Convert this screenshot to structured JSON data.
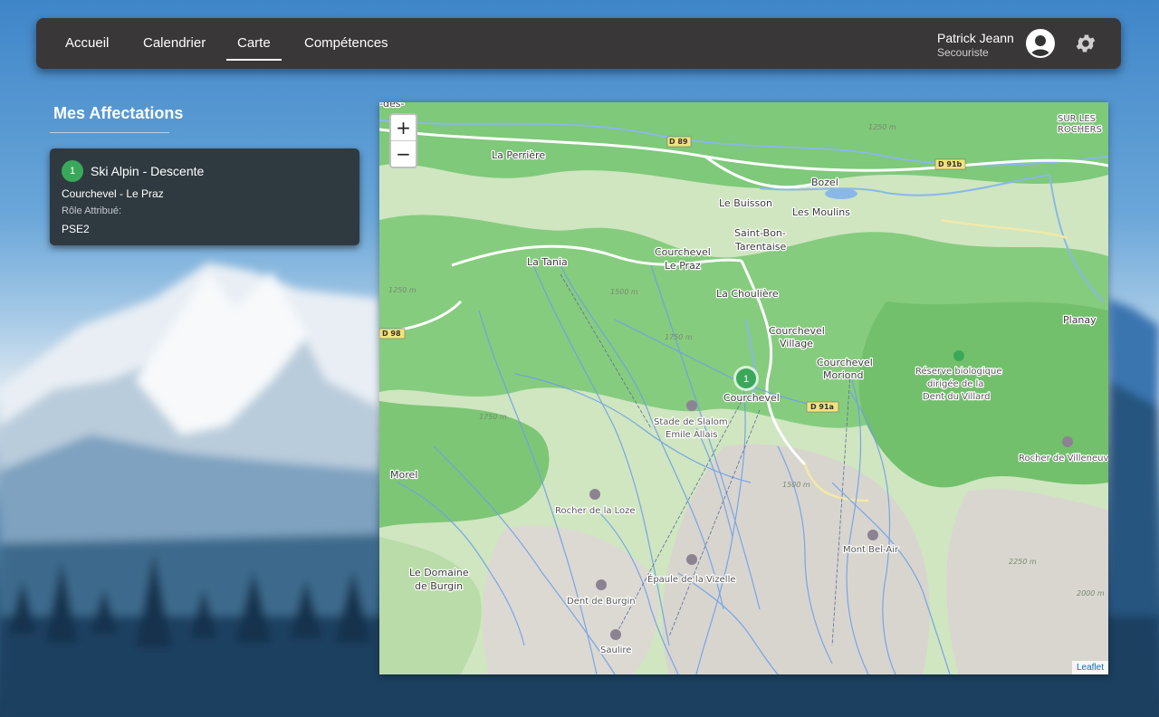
{
  "nav": {
    "items": [
      {
        "label": "Accueil",
        "active": false
      },
      {
        "label": "Calendrier",
        "active": false
      },
      {
        "label": "Carte",
        "active": true
      },
      {
        "label": "Compétences",
        "active": false
      }
    ]
  },
  "user": {
    "name": "Patrick Jeann",
    "role": "Secouriste"
  },
  "sidebar": {
    "title": "Mes Affectations",
    "assignments": [
      {
        "number": "1",
        "title": "Ski Alpin - Descente",
        "location": "Courchevel - Le Praz",
        "role_label": "Rôle Attribué:",
        "role": "PSE2"
      }
    ]
  },
  "map": {
    "zoom_in": "+",
    "zoom_out": "−",
    "attribution": "Leaflet",
    "marker_label": "1",
    "places": {
      "des": "-des-",
      "la_perriere": "La Perrière",
      "bozel": "Bozel",
      "le_buisson": "Le Buisson",
      "les_moulins": "Les Moulins",
      "saint_bon": "Saint-Bon-",
      "tarentaise": "Tarentaise",
      "courchevel_lepraz_1": "Courchevel",
      "courchevel_lepraz_2": "Le Praz",
      "la_tania": "La Tania",
      "la_chouliere": "La Choulière",
      "cv_village_1": "Courchevel",
      "cv_village_2": "Village",
      "cv_moriond_1": "Courchevel",
      "cv_moriond_2": "Moriond",
      "courchevel": "Courchevel",
      "planay": "Planay",
      "reserve_1": "Réserve biologique",
      "reserve_2": "dirigée de la",
      "reserve_3": "Dent du Villard",
      "stade_1": "Stade de Slalom",
      "stade_2": "Emile Allais",
      "morel": "Morel",
      "rocher_loze": "Rocher de la Loze",
      "rocher_villeneuve": "Rocher de Villeneuve",
      "mont_bel_air": "Mont Bel-Air",
      "le_domaine": "Le Domaine",
      "de_burgin": "de Burgin",
      "epaule": "Épaule de la Vizelle",
      "dent_burgin": "Dent de Burgin",
      "saulire": "Saulire",
      "sur_les": "SUR LES",
      "rochers": "ROCHERS"
    },
    "roads": {
      "d89": "D 89",
      "d91b": "D 91b",
      "d98": "D 98",
      "d91a": "D 91a"
    },
    "elevations": {
      "e1250a": "1250 m",
      "e1250b": "1250 m",
      "e1500": "1500 m",
      "e1750": "1750 m",
      "e1750b": "1750 m",
      "e1500b": "1500 m",
      "e2250": "2250 m",
      "e2000": "2000 m"
    },
    "colors": {
      "forest": "#7fc97a",
      "pasture": "#cfe6c0",
      "rock": "#d9d6d0",
      "river": "#8ab8e6",
      "piste": "#6f9fe8",
      "marker": "#3aa85a"
    }
  }
}
